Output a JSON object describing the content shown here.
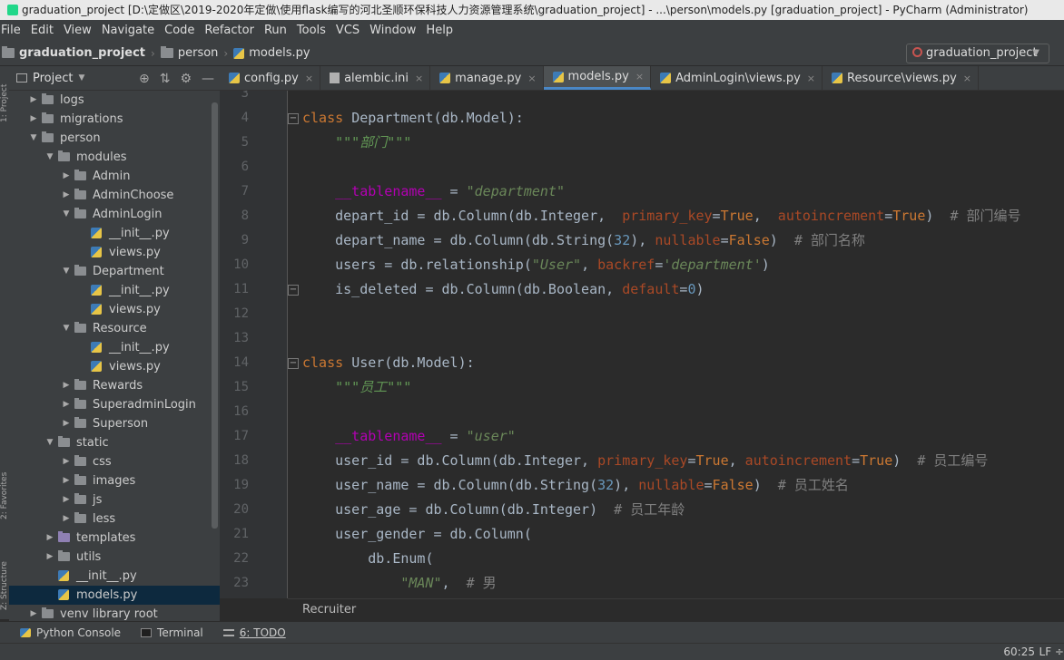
{
  "window": {
    "title": "graduation_project [D:\\定做区\\2019-2020年定做\\使用flask编写的河北圣顺环保科技人力资源管理系统\\graduation_project] - ...\\person\\models.py [graduation_project] - PyCharm (Administrator)"
  },
  "menu": [
    "File",
    "Edit",
    "View",
    "Navigate",
    "Code",
    "Refactor",
    "Run",
    "Tools",
    "VCS",
    "Window",
    "Help"
  ],
  "breadcrumb": {
    "project": "graduation_project",
    "folder": "person",
    "file": "models.py"
  },
  "run_config": {
    "label": "graduation_project"
  },
  "project_panel": {
    "title": "Project"
  },
  "tree": [
    {
      "label": "logs",
      "depth": 0,
      "type": "dir",
      "expanded": false
    },
    {
      "label": "migrations",
      "depth": 0,
      "type": "dir",
      "expanded": false
    },
    {
      "label": "person",
      "depth": 0,
      "type": "dir",
      "expanded": true
    },
    {
      "label": "modules",
      "depth": 1,
      "type": "dir",
      "expanded": true
    },
    {
      "label": "Admin",
      "depth": 2,
      "type": "dir",
      "expanded": false
    },
    {
      "label": "AdminChoose",
      "depth": 2,
      "type": "dir",
      "expanded": false
    },
    {
      "label": "AdminLogin",
      "depth": 2,
      "type": "dir",
      "expanded": true
    },
    {
      "label": "__init__.py",
      "depth": 3,
      "type": "py"
    },
    {
      "label": "views.py",
      "depth": 3,
      "type": "py"
    },
    {
      "label": "Department",
      "depth": 2,
      "type": "dir",
      "expanded": true
    },
    {
      "label": "__init__.py",
      "depth": 3,
      "type": "py"
    },
    {
      "label": "views.py",
      "depth": 3,
      "type": "py"
    },
    {
      "label": "Resource",
      "depth": 2,
      "type": "dir",
      "expanded": true
    },
    {
      "label": "__init__.py",
      "depth": 3,
      "type": "py"
    },
    {
      "label": "views.py",
      "depth": 3,
      "type": "py"
    },
    {
      "label": "Rewards",
      "depth": 2,
      "type": "dir",
      "expanded": false
    },
    {
      "label": "SuperadminLogin",
      "depth": 2,
      "type": "dir",
      "expanded": false
    },
    {
      "label": "Superson",
      "depth": 2,
      "type": "dir",
      "expanded": false
    },
    {
      "label": "static",
      "depth": 1,
      "type": "dir",
      "expanded": true
    },
    {
      "label": "css",
      "depth": 2,
      "type": "dir",
      "expanded": false
    },
    {
      "label": "images",
      "depth": 2,
      "type": "dir",
      "expanded": false
    },
    {
      "label": "js",
      "depth": 2,
      "type": "dir",
      "expanded": false
    },
    {
      "label": "less",
      "depth": 2,
      "type": "dir",
      "expanded": false
    },
    {
      "label": "templates",
      "depth": 1,
      "type": "dir-purple",
      "expanded": false
    },
    {
      "label": "utils",
      "depth": 1,
      "type": "dir",
      "expanded": false
    },
    {
      "label": "__init__.py",
      "depth": 1,
      "type": "py"
    },
    {
      "label": "models.py",
      "depth": 1,
      "type": "py",
      "selected": true
    },
    {
      "label": "venv  library root",
      "depth": 0,
      "type": "dir",
      "expanded": false
    }
  ],
  "tabs": [
    {
      "label": "config.py",
      "icon": "python-file-icon",
      "active": false
    },
    {
      "label": "alembic.ini",
      "icon": "ini-file-icon",
      "active": false
    },
    {
      "label": "manage.py",
      "icon": "python-file-icon",
      "active": false
    },
    {
      "label": "models.py",
      "icon": "python-file-icon",
      "active": true
    },
    {
      "label": "AdminLogin\\views.py",
      "icon": "python-file-icon",
      "active": false
    },
    {
      "label": "Resource\\views.py",
      "icon": "python-file-icon",
      "active": false
    }
  ],
  "code_lines": [
    {
      "n": 3,
      "tokens": []
    },
    {
      "n": 4,
      "tokens": [
        [
          "kw",
          "class "
        ],
        [
          "",
          "Department(db.Model):"
        ]
      ]
    },
    {
      "n": 5,
      "tokens": [
        [
          "",
          "    "
        ],
        [
          "doc",
          "\"\"\"部门\"\"\""
        ]
      ]
    },
    {
      "n": 6,
      "tokens": []
    },
    {
      "n": 7,
      "tokens": [
        [
          "",
          "    "
        ],
        [
          "mag",
          "__tablename__"
        ],
        [
          "",
          " = "
        ],
        [
          "str",
          "\"department\""
        ]
      ]
    },
    {
      "n": 8,
      "tokens": [
        [
          "",
          "    depart_id = db.Column(db.Integer,  "
        ],
        [
          "kwarg",
          "primary_key"
        ],
        [
          "",
          "="
        ],
        [
          "kw",
          "True"
        ],
        [
          "",
          ",  "
        ],
        [
          "kwarg",
          "autoincrement"
        ],
        [
          "",
          "="
        ],
        [
          "kw",
          "True"
        ],
        [
          "",
          ")  "
        ],
        [
          "cmt",
          "# 部门编号"
        ]
      ]
    },
    {
      "n": 9,
      "tokens": [
        [
          "",
          "    depart_name = db.Column(db.String("
        ],
        [
          "num",
          "32"
        ],
        [
          "",
          "), "
        ],
        [
          "kwarg",
          "nullable"
        ],
        [
          "",
          "="
        ],
        [
          "kw",
          "False"
        ],
        [
          "",
          ")  "
        ],
        [
          "cmt",
          "# 部门名称"
        ]
      ]
    },
    {
      "n": 10,
      "tokens": [
        [
          "",
          "    users = db.relationship("
        ],
        [
          "str",
          "\"User\""
        ],
        [
          "",
          ", "
        ],
        [
          "kwarg",
          "backref"
        ],
        [
          "",
          "="
        ],
        [
          "str",
          "'department'"
        ],
        [
          "",
          ")"
        ]
      ]
    },
    {
      "n": 11,
      "tokens": [
        [
          "",
          "    is_deleted = db.Column(db.Boolean, "
        ],
        [
          "kwarg",
          "default"
        ],
        [
          "",
          "="
        ],
        [
          "num",
          "0"
        ],
        [
          "",
          ")"
        ]
      ]
    },
    {
      "n": 12,
      "tokens": []
    },
    {
      "n": 13,
      "tokens": []
    },
    {
      "n": 14,
      "tokens": [
        [
          "kw",
          "class "
        ],
        [
          "",
          "User(db.Model):"
        ]
      ]
    },
    {
      "n": 15,
      "tokens": [
        [
          "",
          "    "
        ],
        [
          "doc",
          "\"\"\"员工\"\"\""
        ]
      ]
    },
    {
      "n": 16,
      "tokens": []
    },
    {
      "n": 17,
      "tokens": [
        [
          "",
          "    "
        ],
        [
          "mag",
          "__tablename__"
        ],
        [
          "",
          " = "
        ],
        [
          "str",
          "\"user\""
        ]
      ]
    },
    {
      "n": 18,
      "tokens": [
        [
          "",
          "    user_id = db.Column(db.Integer, "
        ],
        [
          "kwarg",
          "primary_key"
        ],
        [
          "",
          "="
        ],
        [
          "kw",
          "True"
        ],
        [
          "",
          ", "
        ],
        [
          "kwarg",
          "autoincrement"
        ],
        [
          "",
          "="
        ],
        [
          "kw",
          "True"
        ],
        [
          "",
          ")  "
        ],
        [
          "cmt",
          "# 员工编号"
        ]
      ]
    },
    {
      "n": 19,
      "tokens": [
        [
          "",
          "    user_name = db.Column(db.String("
        ],
        [
          "num",
          "32"
        ],
        [
          "",
          "), "
        ],
        [
          "kwarg",
          "nullable"
        ],
        [
          "",
          "="
        ],
        [
          "kw",
          "False"
        ],
        [
          "",
          ")  "
        ],
        [
          "cmt",
          "# 员工姓名"
        ]
      ]
    },
    {
      "n": 20,
      "tokens": [
        [
          "",
          "    user_age = db.Column(db.Integer)  "
        ],
        [
          "cmt",
          "# 员工年龄"
        ]
      ]
    },
    {
      "n": 21,
      "tokens": [
        [
          "",
          "    user_gender = db.Column("
        ]
      ]
    },
    {
      "n": 22,
      "tokens": [
        [
          "",
          "        db.Enum("
        ]
      ]
    },
    {
      "n": 23,
      "tokens": [
        [
          "",
          "            "
        ],
        [
          "str",
          "\"MAN\""
        ],
        [
          "",
          ",  "
        ],
        [
          "cmt",
          "# 男"
        ]
      ]
    }
  ],
  "editor_breadcrumb": "Recruiter",
  "tool_windows": [
    {
      "label": "Python Console"
    },
    {
      "label": "Terminal"
    },
    {
      "label": "6: TODO"
    }
  ],
  "status": {
    "position": "60:25",
    "line_ending": "LF ÷"
  },
  "side_labels": {
    "structure": "Z: Structure",
    "favorites": "2: Favorites",
    "project": "1: Project"
  }
}
